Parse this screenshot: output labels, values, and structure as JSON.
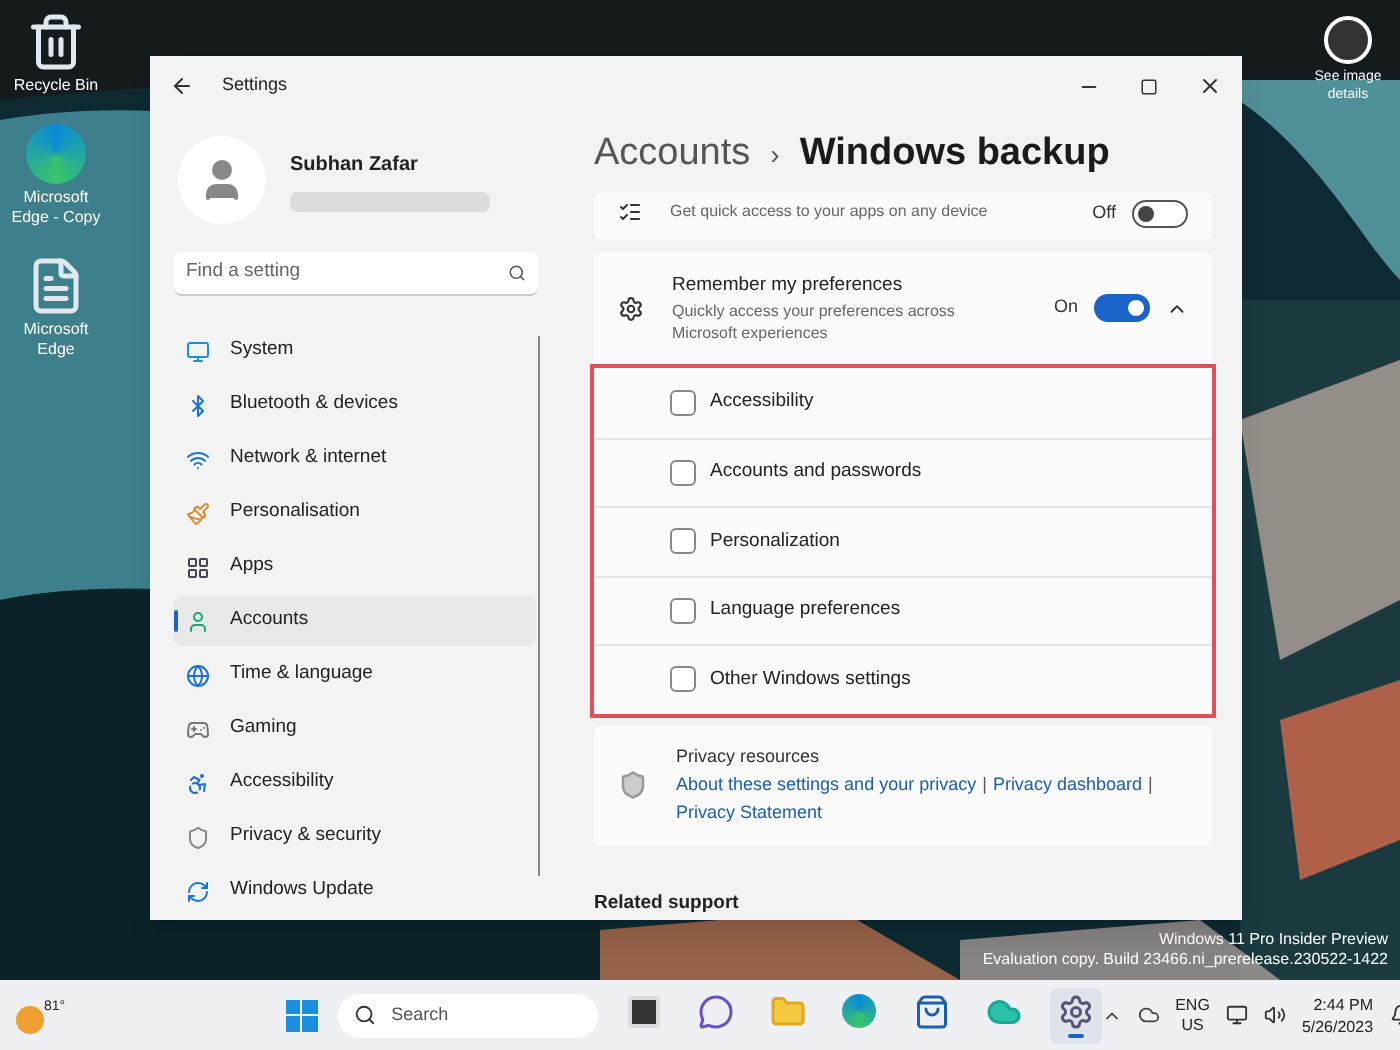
{
  "desktop": {
    "icons": [
      {
        "label": "Recycle Bin"
      },
      {
        "label": "Microsoft Edge - Copy"
      },
      {
        "label": "Microsoft Edge"
      }
    ],
    "corner_link": "See image details",
    "watermark": [
      "Windows 11 Pro Insider Preview",
      "Evaluation copy. Build 23466.ni_prerelease.230522-1422"
    ]
  },
  "window": {
    "title": "Settings",
    "user": "Subhan Zafar",
    "search": {
      "placeholder": "Find a setting"
    },
    "sidebar": {
      "items": [
        {
          "label": "System",
          "selected": false
        },
        {
          "label": "Bluetooth & devices",
          "selected": false
        },
        {
          "label": "Network & internet",
          "selected": false
        },
        {
          "label": "Personalisation",
          "selected": false
        },
        {
          "label": "Apps",
          "selected": false
        },
        {
          "label": "Accounts",
          "selected": true
        },
        {
          "label": "Time & language",
          "selected": false
        },
        {
          "label": "Gaming",
          "selected": false
        },
        {
          "label": "Accessibility",
          "selected": false
        },
        {
          "label": "Privacy & security",
          "selected": false
        },
        {
          "label": "Windows Update",
          "selected": false
        }
      ]
    },
    "breadcrumb": {
      "parent": "Accounts",
      "separator": "›",
      "current": "Windows backup"
    },
    "settings": [
      {
        "kind": "toggle",
        "description": "Get quick access to your apps on any device",
        "state_label": "Off",
        "on": false
      },
      {
        "kind": "expander",
        "title": "Remember my preferences",
        "description": "Quickly access your preferences across Microsoft experiences",
        "state_label": "On",
        "on": true,
        "expanded": true,
        "options": [
          {
            "label": "Accessibility",
            "checked": false
          },
          {
            "label": "Accounts and passwords",
            "checked": false
          },
          {
            "label": "Personalization",
            "checked": false
          },
          {
            "label": "Language preferences",
            "checked": false
          },
          {
            "label": "Other Windows settings",
            "checked": false
          }
        ]
      }
    ],
    "privacy": {
      "title": "Privacy resources",
      "separator": "|",
      "links": [
        "About these settings and your privacy",
        "Privacy dashboard",
        "Privacy Statement"
      ]
    },
    "related_heading": "Related support"
  },
  "taskbar": {
    "weather": "81°",
    "search_placeholder": "Search",
    "apps": [
      {
        "kind": "widgets",
        "selected": false
      },
      {
        "kind": "chat",
        "selected": false
      },
      {
        "kind": "folder",
        "selected": false
      },
      {
        "kind": "edge",
        "selected": false
      },
      {
        "kind": "store",
        "selected": false
      },
      {
        "kind": "cloud",
        "selected": false
      },
      {
        "kind": "settings",
        "selected": true
      }
    ],
    "language": [
      "ENG",
      "US"
    ],
    "time": "2:44 PM",
    "date": "5/26/2023"
  }
}
